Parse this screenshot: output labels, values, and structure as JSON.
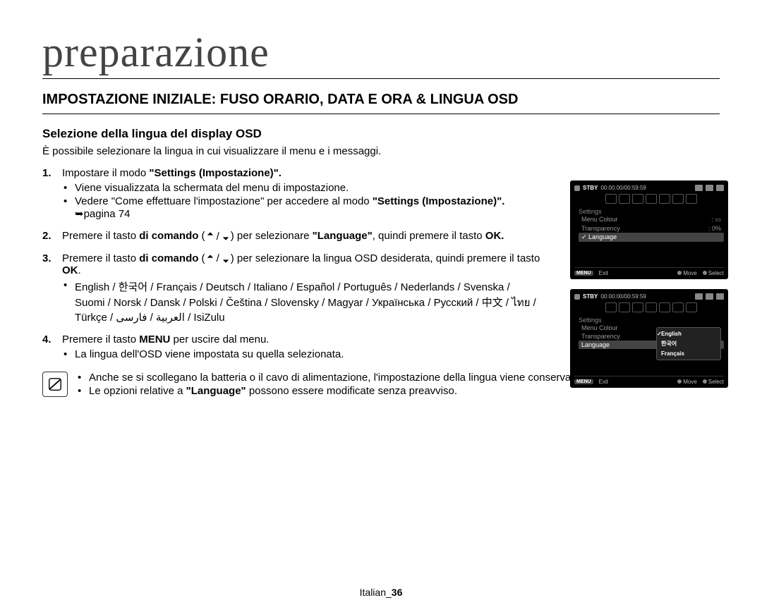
{
  "title": "preparazione",
  "heading": "IMPOSTAZIONE INIZIALE: FUSO ORARIO, DATA E ORA & LINGUA OSD",
  "subheading": "Selezione della lingua del display OSD",
  "intro": "È possibile selezionare la lingua in cui visualizzare il menu e i messaggi.",
  "steps": {
    "s1": {
      "num": "1.",
      "lead": "Impostare il modo ",
      "bold": "\"Settings (Impostazione)\".",
      "b1": "Viene visualizzata la schermata del menu di impostazione.",
      "b2a": "Vedere \"Come effettuare l'impostazione\" per accedere al modo ",
      "b2b": "\"Settings (Impostazione)\".",
      "b2c": " ➥pagina 74"
    },
    "s2": {
      "num": "2.",
      "t1": "Premere il tasto ",
      "t_bold1": "di comando",
      "t_mid": " (",
      "t2": ") per selezionare ",
      "t_bold2": "\"Language\"",
      "t3": ", quindi premere il tasto ",
      "t_bold3": "OK."
    },
    "s3": {
      "num": "3.",
      "t1": "Premere il tasto ",
      "t_bold1": "di comando",
      "t_mid": "  (",
      "t2": ") per selezionare la lingua OSD desiderata, quindi premere il tasto ",
      "t_bold2": "OK",
      "t3": ".",
      "b1": "English / 한국어 / Français / Deutsch / Italiano / Español / Português / Nederlands / Svenska / Suomi / Norsk / Dansk / Polski / Čeština / Slovensky / Magyar / Українська / Русский / 中文 / ไทย / Türkçe / العربية / فارسی / IsiZulu"
    },
    "s4": {
      "num": "4.",
      "t1": "Premere il tasto ",
      "t_bold1": "MENU",
      "t2": " per uscire dal menu.",
      "b1": "La lingua dell'OSD viene impostata su quella selezionata."
    }
  },
  "notes": {
    "n1": "Anche se si scollegano la batteria o il cavo di alimentazione, l'impostazione della lingua viene conservata.",
    "n2a": "Le opzioni relative a ",
    "n2b": "\"Language\"",
    "n2c": " possono essere modificate senza preavviso."
  },
  "footer": {
    "lang": "Italian_",
    "page": "36"
  },
  "osd": {
    "stby": "STBY",
    "time": "00:00:00/00:59:59",
    "settings": "Settings",
    "menu_colour": "Menu Colour",
    "transparency": "Transparency",
    "transparency_val": ": 0%",
    "language": "Language",
    "menu_tag": "MENU",
    "exit": "Exit",
    "move": "Move",
    "select": "Select",
    "popup": {
      "english": "English",
      "korean": "한국어",
      "francais": "Français"
    }
  }
}
